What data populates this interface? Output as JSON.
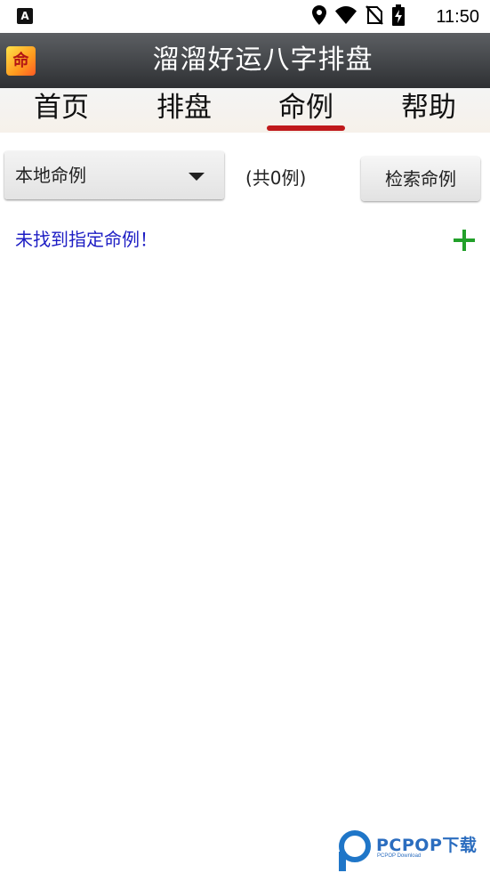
{
  "status_bar": {
    "left_icon_label": "A",
    "time": "11:50",
    "icons": [
      "location-icon",
      "wifi-icon",
      "no-sim-icon",
      "battery-charging-icon"
    ]
  },
  "app": {
    "title": "溜溜好运八字排盘",
    "logo_glyph": "命"
  },
  "tabs": [
    {
      "label": "首页",
      "active": false
    },
    {
      "label": "排盘",
      "active": false
    },
    {
      "label": "命例",
      "active": true
    },
    {
      "label": "帮助",
      "active": false
    }
  ],
  "toolbar": {
    "source_selected": "本地命例",
    "count_text": "(共0例)",
    "search_label": "检索命例"
  },
  "content": {
    "empty_message": "未找到指定命例！"
  },
  "watermark": {
    "text": "PCPOP下载",
    "subtext": "PCPOP Download"
  },
  "colors": {
    "tab_indicator": "#c0191b",
    "empty_message": "#1d1dc4",
    "add_icon": "#22a02a",
    "title_bar": "#3e4044"
  }
}
